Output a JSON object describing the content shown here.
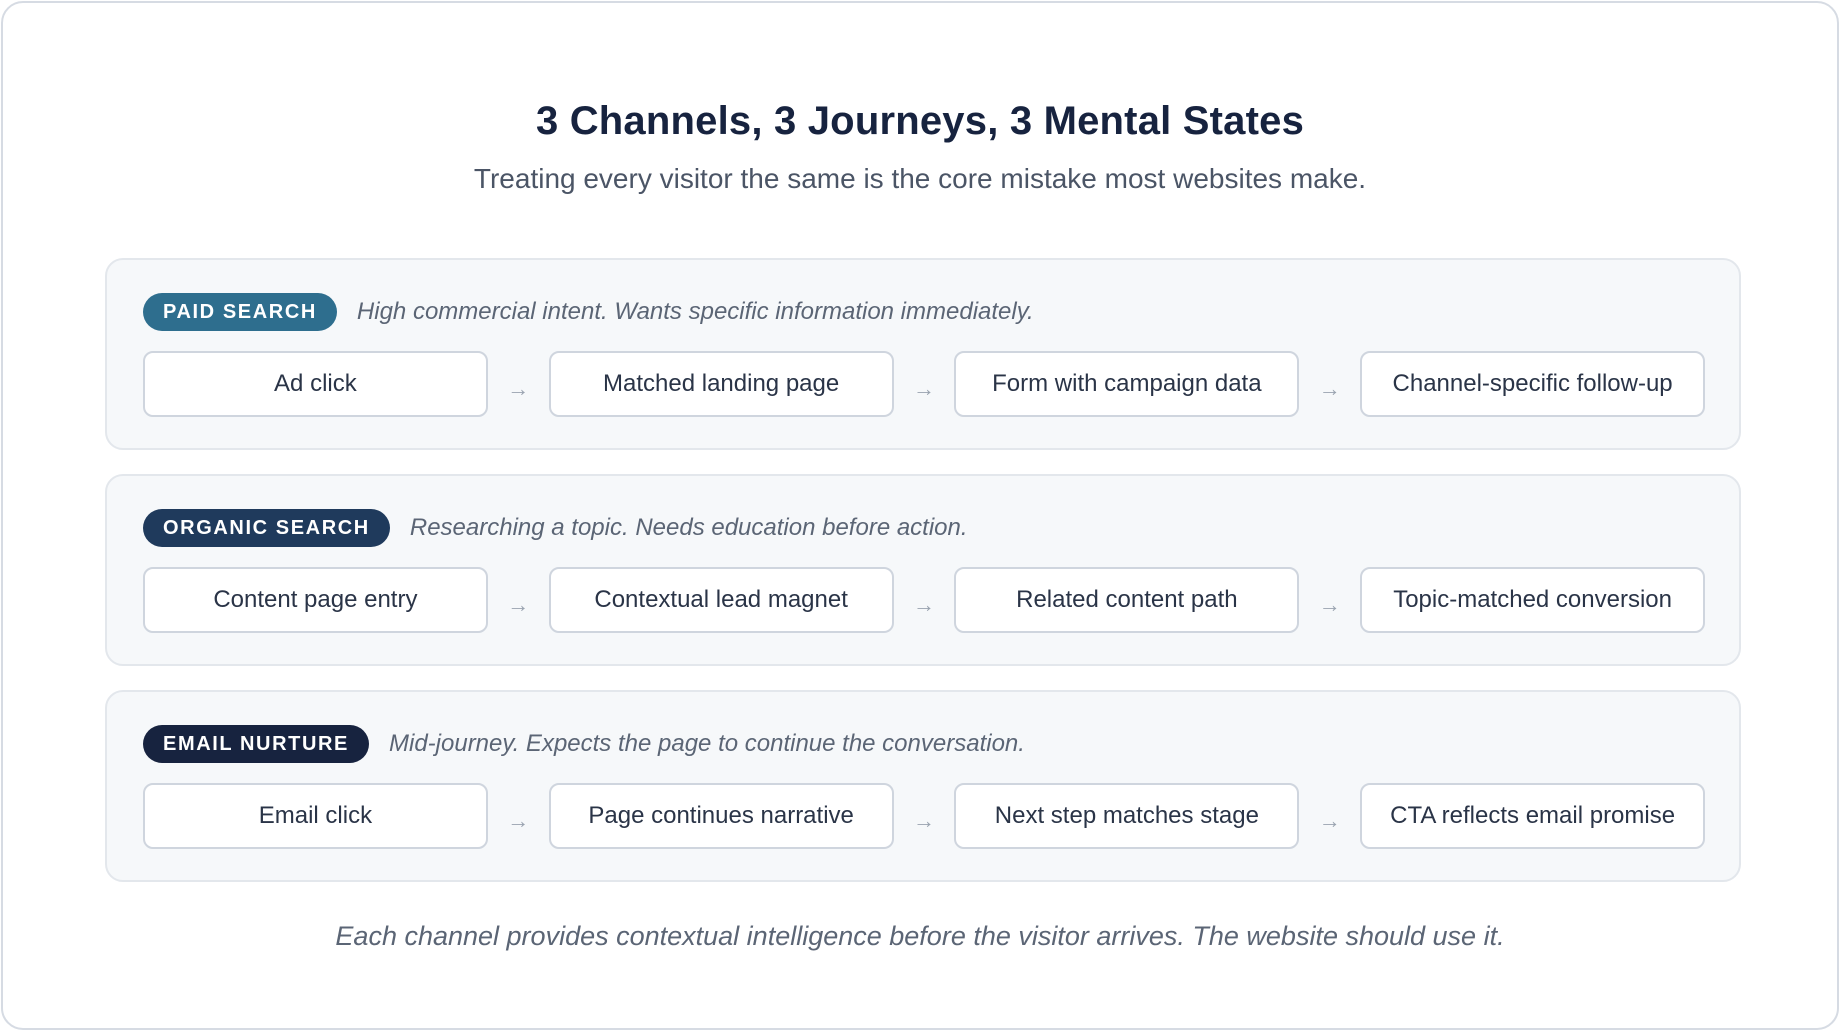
{
  "header": {
    "title": "3 Channels, 3 Journeys, 3 Mental States",
    "subtitle": "Treating every visitor the same is the core mistake most websites make."
  },
  "colors": {
    "paid": "#2e6e8e",
    "organic": "#1f3a5c",
    "email": "#17233f"
  },
  "arrow": "→",
  "channels": [
    {
      "badge": "PAID SEARCH",
      "description": "High commercial intent. Wants specific information immediately.",
      "steps": [
        "Ad click",
        "Matched landing page",
        "Form with campaign data",
        "Channel-specific follow-up"
      ]
    },
    {
      "badge": "ORGANIC SEARCH",
      "description": "Researching a topic. Needs education before action.",
      "steps": [
        "Content page entry",
        "Contextual lead magnet",
        "Related content path",
        "Topic-matched conversion"
      ]
    },
    {
      "badge": "EMAIL NURTURE",
      "description": "Mid-journey. Expects the page to continue the conversation.",
      "steps": [
        "Email click",
        "Page continues narrative",
        "Next step matches stage",
        "CTA reflects email promise"
      ]
    }
  ],
  "footer": "Each channel provides contextual intelligence before the visitor arrives. The website should use it."
}
